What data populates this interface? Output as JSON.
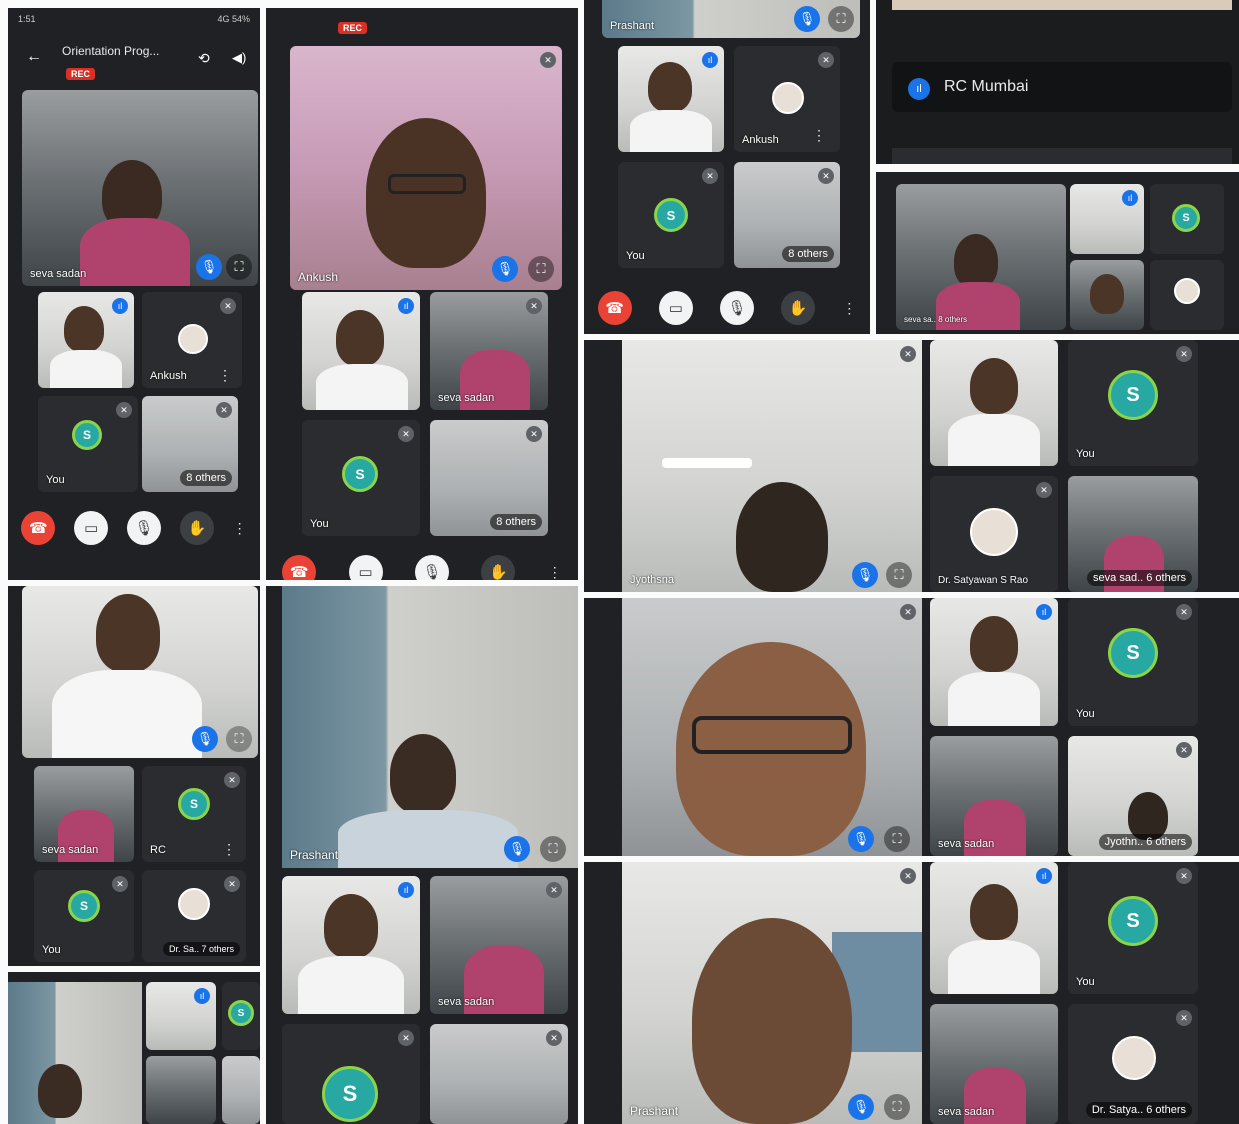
{
  "status_bar": {
    "time": "1:51",
    "right": "4G 54%"
  },
  "call": {
    "title": "Orientation Prog...",
    "rec_badge": "REC"
  },
  "participants": {
    "seva_sadan": "seva sadan",
    "seva_sadan_short": "seva sadan",
    "ankush": "Ankush",
    "you": "You",
    "prashant": "Prashant",
    "rc": "RC",
    "rc_mumbai": "RC Mumbai",
    "dr_satyawan": "Dr. Satyawan S Rao",
    "jyothsna": "Jyothsna"
  },
  "overflow": {
    "eight_others": "8 others",
    "seven_others": "Dr. Sa.. 7 others",
    "six_others_seva": "seva sad.. 6 others",
    "six_others_j": "Jyothn.. 6 others",
    "six_others_dr": "Dr. Satya.. 6 others",
    "tiny_seva": "seva sa..  8 others"
  },
  "colors": {
    "panel_bg": "#202124",
    "end_call": "#ea4335",
    "accent": "#1a73e8",
    "rec": "#d93025"
  },
  "icons": [
    "back-arrow-icon",
    "switch-camera-icon",
    "speaker-icon",
    "mic-icon",
    "pin-icon",
    "end-call-icon",
    "camera-off-icon",
    "mic-off-icon",
    "raise-hand-icon",
    "more-icon",
    "audio-wave-icon",
    "app-logo-icon"
  ]
}
